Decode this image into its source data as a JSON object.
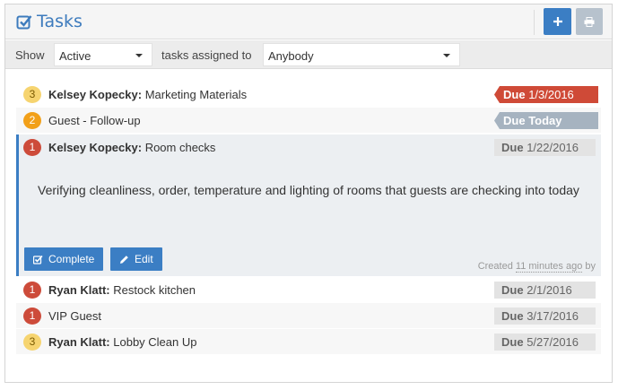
{
  "header": {
    "title": "Tasks"
  },
  "filters": {
    "show_label": "Show",
    "status_value": "Active",
    "assigned_label": "tasks assigned to",
    "assignee_value": "Anybody"
  },
  "tasks": [
    {
      "priority": "3",
      "assignee": "Kelsey Kopecky:",
      "title": "Marketing Materials",
      "due_label": "Due",
      "due_date": "1/3/2016",
      "status": "overdue"
    },
    {
      "priority": "2",
      "assignee": "",
      "title": "Guest - Follow-up",
      "due_label": "Due",
      "due_date": "Today",
      "status": "today"
    },
    {
      "priority": "1",
      "assignee": "Kelsey Kopecky:",
      "title": "Room checks",
      "due_label": "Due",
      "due_date": "1/22/2016",
      "status": "normal",
      "description": "Verifying cleanliness, order, temperature and lighting of rooms that guests are checking into today",
      "complete_label": "Complete",
      "edit_label": "Edit",
      "created_prefix": "Created",
      "created_ago": "11 minutes ago",
      "created_suffix": "by"
    },
    {
      "priority": "1",
      "assignee": "Ryan Klatt:",
      "title": "Restock kitchen",
      "due_label": "Due",
      "due_date": "2/1/2016",
      "status": "normal"
    },
    {
      "priority": "1",
      "assignee": "",
      "title": "VIP Guest",
      "due_label": "Due",
      "due_date": "3/17/2016",
      "status": "normal"
    },
    {
      "priority": "3",
      "assignee": "Ryan Klatt:",
      "title": "Lobby Clean Up",
      "due_label": "Due",
      "due_date": "5/27/2016",
      "status": "normal"
    }
  ],
  "colors": {
    "accent": "#3b7ec4",
    "priority_1": "#cd4b3a",
    "priority_2": "#f2a019",
    "priority_3": "#f6d470",
    "overdue": "#cf4a37",
    "today": "#a6b3c0"
  },
  "icons": {
    "title": "checkbox-icon",
    "add": "plus-icon",
    "print": "print-icon",
    "complete": "checkbox-icon",
    "edit": "pencil-icon"
  }
}
